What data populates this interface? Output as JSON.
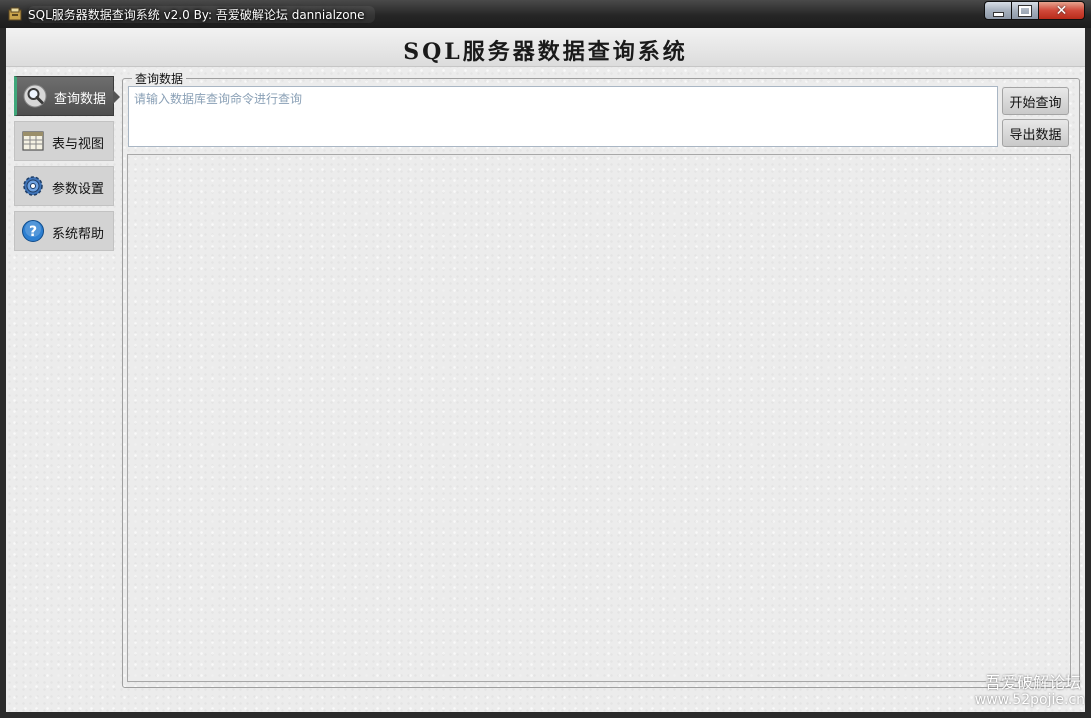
{
  "window": {
    "title": "SQL服务器数据查询系统 v2.0  By: 吾爱破解论坛 dannialzone"
  },
  "banner": {
    "title": "SQL服务器数据查询系统"
  },
  "nav": {
    "items": [
      {
        "label": "查询数据",
        "icon": "search-icon",
        "active": true
      },
      {
        "label": "表与视图",
        "icon": "table-icon",
        "active": false
      },
      {
        "label": "参数设置",
        "icon": "gear-icon",
        "active": false
      },
      {
        "label": "系统帮助",
        "icon": "help-icon",
        "active": false
      }
    ]
  },
  "query": {
    "group_label": "查询数据",
    "placeholder": "请输入数据库查询命令进行查询",
    "start_button": "开始查询",
    "export_button": "导出数据"
  },
  "watermark": {
    "line1": "吾爱破解论坛",
    "line2": "www.52pojie.cn"
  },
  "colors": {
    "active_nav_bg": "#5a5a5a",
    "active_nav_accent": "#3fa77a",
    "close_button": "#c94131",
    "placeholder_text": "#8aa0b6"
  }
}
